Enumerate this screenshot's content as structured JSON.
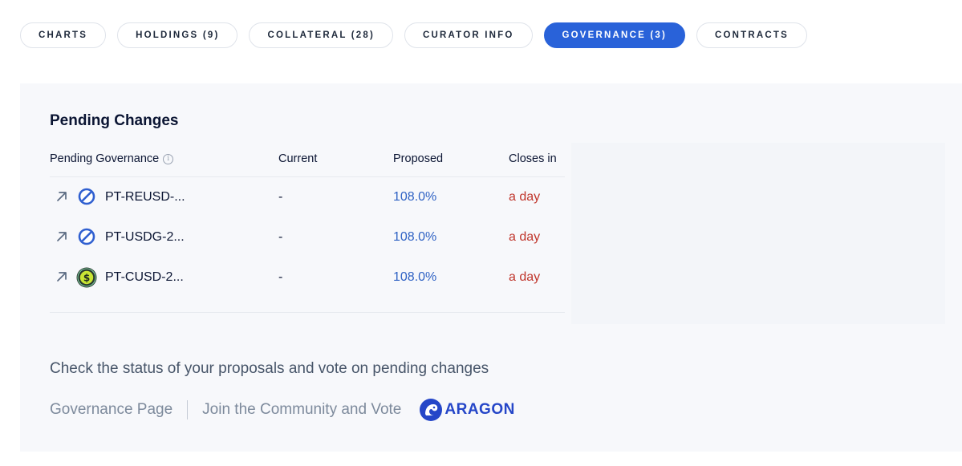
{
  "tabs": [
    {
      "label": "CHARTS",
      "active": false
    },
    {
      "label": "HOLDINGS (9)",
      "active": false
    },
    {
      "label": "COLLATERAL (28)",
      "active": false
    },
    {
      "label": "CURATOR INFO",
      "active": false
    },
    {
      "label": "GOVERNANCE (3)",
      "active": true
    },
    {
      "label": "CONTRACTS",
      "active": false
    }
  ],
  "pending": {
    "title": "Pending Changes",
    "columns": {
      "governance": "Pending Governance",
      "current": "Current",
      "proposed": "Proposed",
      "closes": "Closes in"
    },
    "rows": [
      {
        "icon": "blocked-circle-icon",
        "name": "PT-REUSD-...",
        "current": "-",
        "proposed": "108.0%",
        "closes": "a day"
      },
      {
        "icon": "blocked-circle-icon",
        "name": "PT-USDG-2...",
        "current": "-",
        "proposed": "108.0%",
        "closes": "a day"
      },
      {
        "icon": "dollar-coin-icon",
        "name": "PT-CUSD-2...",
        "current": "-",
        "proposed": "108.0%",
        "closes": "a day"
      }
    ]
  },
  "footer": {
    "cta": "Check the status of your proposals and vote on pending changes",
    "governance_link": "Governance Page",
    "community_link": "Join the Community and Vote",
    "aragon_label": "ARAGON"
  },
  "colors": {
    "accent": "#2962d9",
    "proposed": "#2f62c4",
    "closes": "#c0352b",
    "aragon": "#2546c8"
  }
}
